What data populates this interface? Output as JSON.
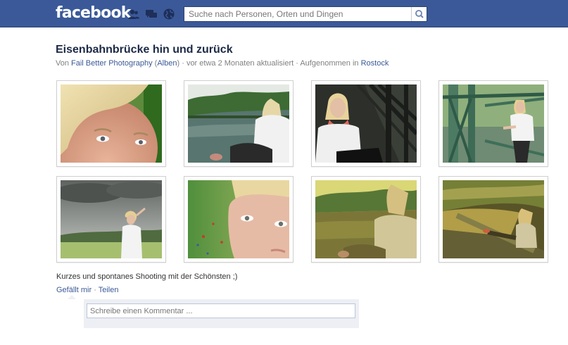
{
  "header": {
    "logo": "facebook",
    "search": {
      "placeholder": "Suche nach Personen, Orten und Dingen",
      "value": ""
    },
    "icons": [
      "friend-requests-icon",
      "messages-icon",
      "notifications-globe-icon",
      "search-icon"
    ],
    "colors": {
      "bar": "#3b5998",
      "link": "#3b5998"
    }
  },
  "album": {
    "title": "Eisenbahnbrücke hin und zurück",
    "meta": {
      "by": "Von",
      "author": "Fail Better Photography",
      "paren_open": "(",
      "albums_link": "Alben",
      "paren_close": ")",
      "updated": "· vor etwa 2 Monaten aktualisiert · Aufgenommen in",
      "location": "Rostock"
    },
    "caption": "Kurzes und spontanes Shooting mit der Schönsten ;)",
    "actions": {
      "like": "Gefällt mir",
      "sep": "·",
      "share": "Teilen"
    },
    "comment": {
      "placeholder": "Schreibe einen Kommentar ..."
    }
  }
}
